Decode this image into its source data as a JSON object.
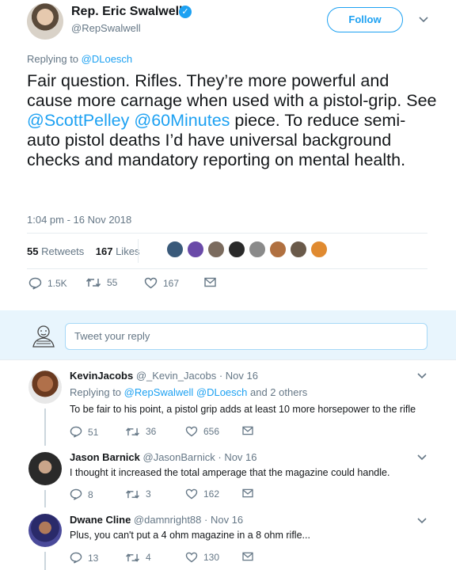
{
  "tweet": {
    "author_name": "Rep. Eric Swalwell",
    "author_handle": "@RepSwalwell",
    "follow_label": "Follow",
    "replying_prefix": "Replying to ",
    "replying_to": "@DLoesch",
    "text_parts": [
      "Fair question. Rifles. They’re more powerful and cause more carnage when used with a pistol-grip. See ",
      "@ScottPelley",
      " ",
      "@60Minutes",
      " piece. To reduce semi-auto pistol deaths I’d have universal background checks and mandatory reporting on mental health."
    ],
    "timestamp": "1:04 pm - 16 Nov 2018",
    "retweets_count": "55",
    "retweets_label": "Retweets",
    "likes_count": "167",
    "likes_label": "Likes",
    "actions": {
      "replies": "1.5K",
      "retweets": "55",
      "likes": "167"
    },
    "liker_colors": [
      "#3a5a7a",
      "#6a4aa8",
      "#7b6b5e",
      "#2a2a2a",
      "#8a8a8a",
      "#b07040",
      "#6a5a4a",
      "#e08a30"
    ]
  },
  "composer": {
    "placeholder": "Tweet your reply"
  },
  "replies": [
    {
      "name": "KevinJacobs",
      "handle": "@_Kevin_Jacobs",
      "date": "Nov 16",
      "replying_prefix": "Replying to ",
      "replying_users": "@RepSwalwell @DLoesch",
      "replying_suffix": " and 2 others",
      "text": "To be fair to his point, a pistol grip adds at least 10 more horsepower to the rifle",
      "replies": "51",
      "retweets": "36",
      "likes": "656"
    },
    {
      "name": "Jason Barnick",
      "handle": "@JasonBarnick",
      "date": "Nov 16",
      "text": "I thought it increased the total amperage that the magazine could handle.",
      "replies": "8",
      "retweets": "3",
      "likes": "162"
    },
    {
      "name": "Dwane Cline",
      "handle": "@damnright88",
      "date": "Nov 16",
      "text": "Plus, you can't put a 4 ohm magazine in a 8 ohm rifle...",
      "replies": "13",
      "retweets": "4",
      "likes": "130"
    }
  ],
  "icons": {
    "reply": "reply-icon",
    "retweet": "retweet-icon",
    "like": "heart-icon",
    "dm": "envelope-icon",
    "verified": "verified-badge-icon",
    "caret": "chevron-down-icon"
  },
  "colors": {
    "accent": "#1da1f2",
    "text": "#14171a",
    "muted": "#657786",
    "composer_bg": "#e8f5fd"
  }
}
